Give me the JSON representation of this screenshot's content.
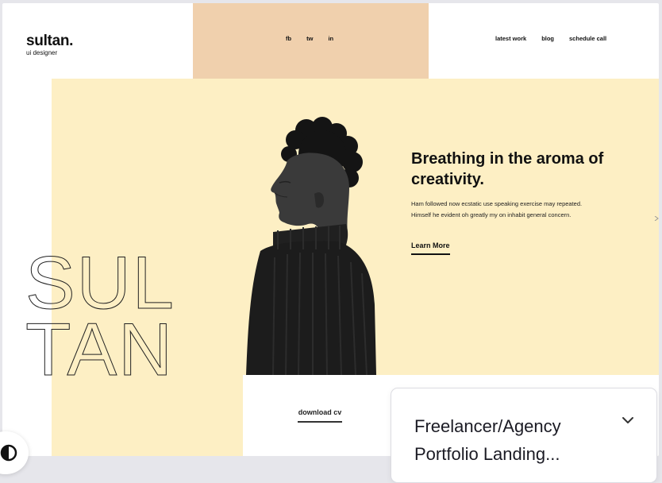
{
  "logo": {
    "title": "sultan.",
    "subtitle": "ui designer"
  },
  "social": [
    "fb",
    "tw",
    "in"
  ],
  "nav": [
    "latest work",
    "blog",
    "schedule call"
  ],
  "hero": {
    "outline_line1": "SUL",
    "outline_line2": "TAN",
    "title": "Breathing in the aroma of creativity.",
    "body": "Ham followed now ecstatic use speaking exercise may repeated. Himself he evident oh greatly my on inhabit general concern.",
    "cta": "Learn More"
  },
  "footer": {
    "download": "download cv"
  },
  "card": {
    "title": "Freelancer/Agency Portfolio Landing..."
  },
  "colors": {
    "peach": "#f0d0ad",
    "cream": "#fdefc4",
    "text": "#111111",
    "background": "#e6e6eb"
  },
  "icons": {
    "card_toggle": "chevron-down-icon",
    "theme_toggle": "contrast-icon"
  }
}
